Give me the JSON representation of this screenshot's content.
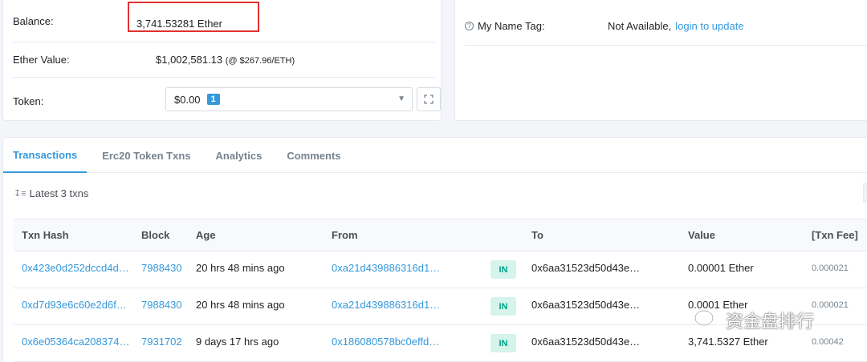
{
  "overview": {
    "balance": {
      "label": "Balance:",
      "value": "3,741.53281 Ether"
    },
    "ether_value": {
      "label": "Ether Value:",
      "value": "$1,002,581.13",
      "rate": "(@ $267.96/ETH)"
    },
    "token": {
      "label": "Token:",
      "value": "$0.00",
      "count": "1"
    }
  },
  "more_info": {
    "name_tag_label": "My Name Tag:",
    "name_tag_value": "Not Available,",
    "name_tag_link": "login to update"
  },
  "tabs": [
    {
      "label": "Transactions",
      "active": true
    },
    {
      "label": "Erc20 Token Txns",
      "active": false
    },
    {
      "label": "Analytics",
      "active": false
    },
    {
      "label": "Comments",
      "active": false
    }
  ],
  "latest": "Latest 3 txns",
  "table": {
    "headers": {
      "hash": "Txn Hash",
      "block": "Block",
      "age": "Age",
      "from": "From",
      "to": "To",
      "value": "Value",
      "fee": "[Txn Fee]"
    },
    "rows": [
      {
        "hash": "0x423e0d252dccd4d…",
        "block": "7988430",
        "age": "20 hrs 48 mins ago",
        "from": "0xa21d439886316d1…",
        "direction": "IN",
        "to": "0x6aa31523d50d43e…",
        "value": "0.00001 Ether",
        "fee": "0.000021"
      },
      {
        "hash": "0xd7d93e6c60e2d6f…",
        "block": "7988430",
        "age": "20 hrs 48 mins ago",
        "from": "0xa21d439886316d1…",
        "direction": "IN",
        "to": "0x6aa31523d50d43e…",
        "value": "0.0001 Ether",
        "fee": "0.000021"
      },
      {
        "hash": "0x6e05364ca208374…",
        "block": "7931702",
        "age": "9 days 17 hrs ago",
        "from": "0x186080578bc0effd…",
        "direction": "IN",
        "to": "0x6aa31523d50d43e…",
        "value": "3,741.5327 Ether",
        "fee": "0.00042"
      }
    ]
  },
  "watermark": "资金盘排行",
  "colors": {
    "link": "#3498db",
    "highlight_border": "#e03131",
    "in_badge_bg": "#d4f4ec",
    "in_badge_text": "#00a186"
  }
}
